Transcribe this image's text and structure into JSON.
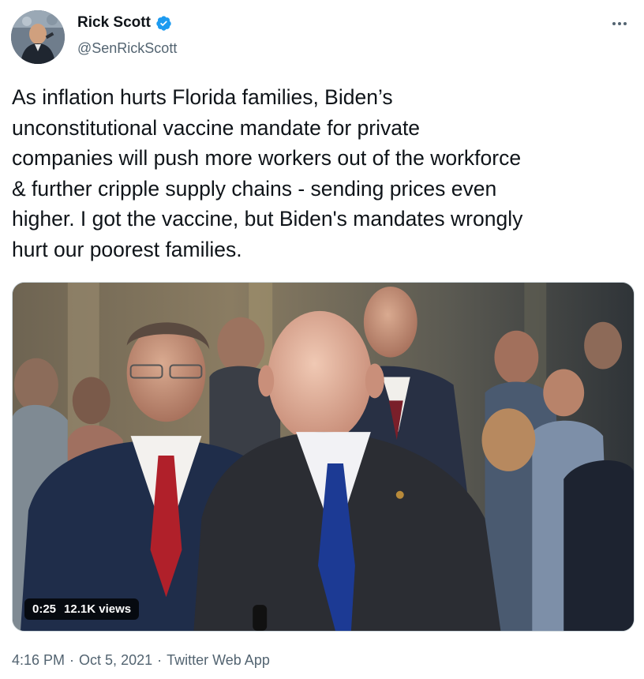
{
  "author": {
    "display_name": "Rick Scott",
    "handle": "@SenRickScott",
    "verified": true
  },
  "tweet": {
    "text": "As inflation hurts Florida families, Biden’s\nunconstitutional vaccine mandate for private\ncompanies will push more workers out of the workforce\n& further cripple supply chains - sending prices even\nhigher. I got the vaccine, but Biden's mandates wrongly\nhurt our poorest families."
  },
  "media": {
    "type": "video",
    "duration": "0:25",
    "views": "12.1K views"
  },
  "footer": {
    "time": "4:16 PM",
    "separator": "·",
    "date": "Oct 5, 2021",
    "source": "Twitter Web App"
  },
  "colors": {
    "verified_badge": "#1d9bf0",
    "secondary_text": "#536471",
    "primary_text": "#0f1419"
  },
  "icons": {
    "more": "more-dots-icon",
    "verified": "verified-badge-icon"
  }
}
